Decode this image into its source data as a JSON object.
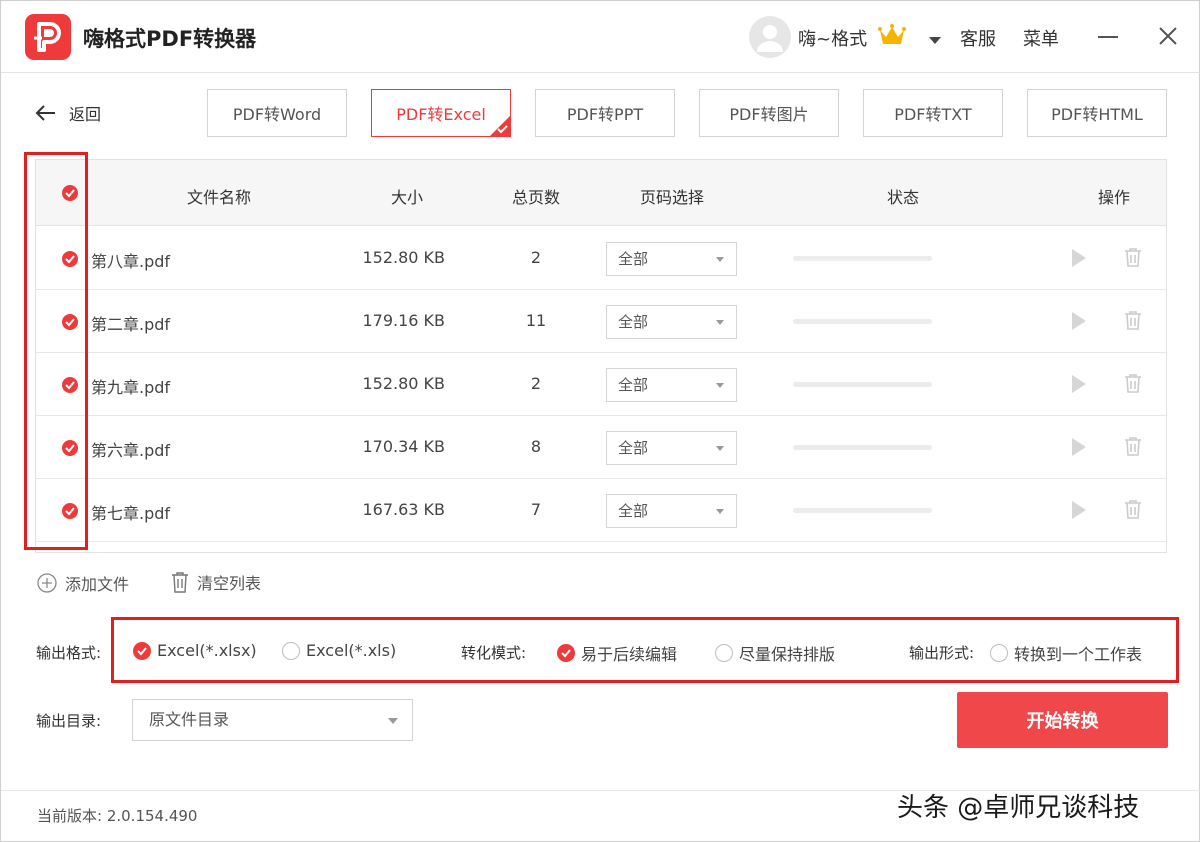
{
  "app": {
    "title": "嗨格式PDF转换器"
  },
  "header": {
    "username": "嗨~格式",
    "service_label": "客服",
    "menu_label": "菜单"
  },
  "nav": {
    "back_label": "返回",
    "tabs": [
      {
        "label": "PDF转Word",
        "active": false
      },
      {
        "label": "PDF转Excel",
        "active": true
      },
      {
        "label": "PDF转PPT",
        "active": false
      },
      {
        "label": "PDF转图片",
        "active": false
      },
      {
        "label": "PDF转TXT",
        "active": false
      },
      {
        "label": "PDF转HTML",
        "active": false
      }
    ]
  },
  "table": {
    "headers": {
      "filename": "文件名称",
      "size": "大小",
      "pages": "总页数",
      "page_select": "页码选择",
      "status": "状态",
      "actions": "操作"
    },
    "rows": [
      {
        "name": "第八章.pdf",
        "size": "152.80 KB",
        "pages": "2",
        "page_select": "全部",
        "checked": true,
        "progress": 0
      },
      {
        "name": "第二章.pdf",
        "size": "179.16 KB",
        "pages": "11",
        "page_select": "全部",
        "checked": true,
        "progress": 0
      },
      {
        "name": "第九章.pdf",
        "size": "152.80 KB",
        "pages": "2",
        "page_select": "全部",
        "checked": true,
        "progress": 0
      },
      {
        "name": "第六章.pdf",
        "size": "170.34 KB",
        "pages": "8",
        "page_select": "全部",
        "checked": true,
        "progress": 0
      },
      {
        "name": "第七章.pdf",
        "size": "167.63 KB",
        "pages": "7",
        "page_select": "全部",
        "checked": true,
        "progress": 0
      }
    ]
  },
  "list_actions": {
    "add_file": "添加文件",
    "clear_list": "清空列表"
  },
  "options": {
    "output_format_label": "输出格式:",
    "format_xlsx": "Excel(*.xlsx)",
    "format_xls": "Excel(*.xls)",
    "convert_mode_label": "转化模式:",
    "mode_edit": "易于后续编辑",
    "mode_layout": "尽量保持排版",
    "output_form_label": "输出形式:",
    "form_single_sheet": "转换到一个工作表",
    "output_dir_label": "输出目录:",
    "output_dir_value": "原文件目录",
    "start_button": "开始转换"
  },
  "footer": {
    "version": "当前版本: 2.0.154.490",
    "watermark": "头条 @卓师兄谈科技"
  },
  "colors": {
    "accent": "#ee3a3a",
    "start_button": "#f0484a",
    "highlight_box": "#e02020"
  }
}
